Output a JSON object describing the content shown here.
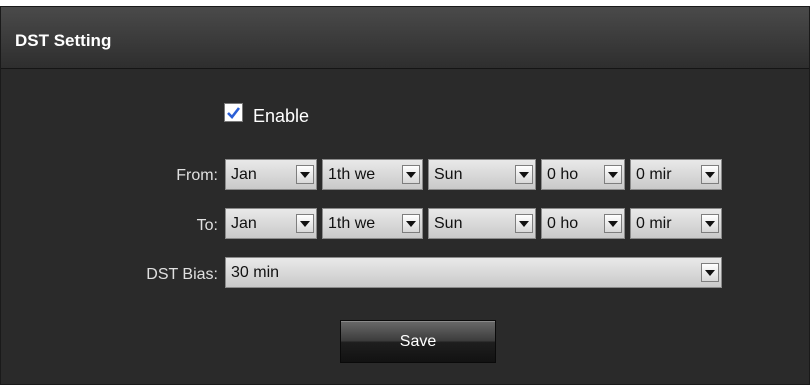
{
  "header": {
    "title": "DST Setting"
  },
  "enable": {
    "label": "Enable",
    "checked": true
  },
  "from": {
    "label": "From:",
    "month": "Jan",
    "week": "1th we",
    "day": "Sun",
    "hour": "0 ho",
    "minute": "0 mir"
  },
  "to": {
    "label": "To:",
    "month": "Jan",
    "week": "1th we",
    "day": "Sun",
    "hour": "0 ho",
    "minute": "0 mir"
  },
  "bias": {
    "label": "DST Bias:",
    "value": "30 min"
  },
  "save": {
    "label": "Save"
  },
  "icons": {
    "dropdown": "chevron-down-icon",
    "check": "checkmark-icon"
  }
}
